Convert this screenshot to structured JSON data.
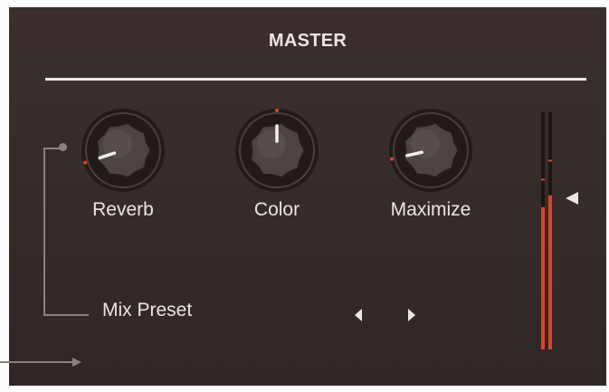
{
  "panel": {
    "title": "MASTER",
    "accent_color": "#d8452a",
    "background_color": "#372e2c"
  },
  "knobs": [
    {
      "name": "reverb",
      "label": "Reverb",
      "value": 0.1
    },
    {
      "name": "color",
      "label": "Color",
      "value": 0.5
    },
    {
      "name": "maximize",
      "label": "Maximize",
      "value": 0.12
    }
  ],
  "mix_preset": {
    "label": "Mix Preset",
    "prev_icon": "triangle-left-icon",
    "next_icon": "triangle-right-icon"
  },
  "output_meter": {
    "left_level": 0.6,
    "right_level": 0.65,
    "left_peak": 0.72,
    "right_peak": 0.8,
    "threshold_icon": "triangle-left-icon",
    "threshold_level": 0.62
  },
  "output_arrow_icon": "arrow-right-icon"
}
